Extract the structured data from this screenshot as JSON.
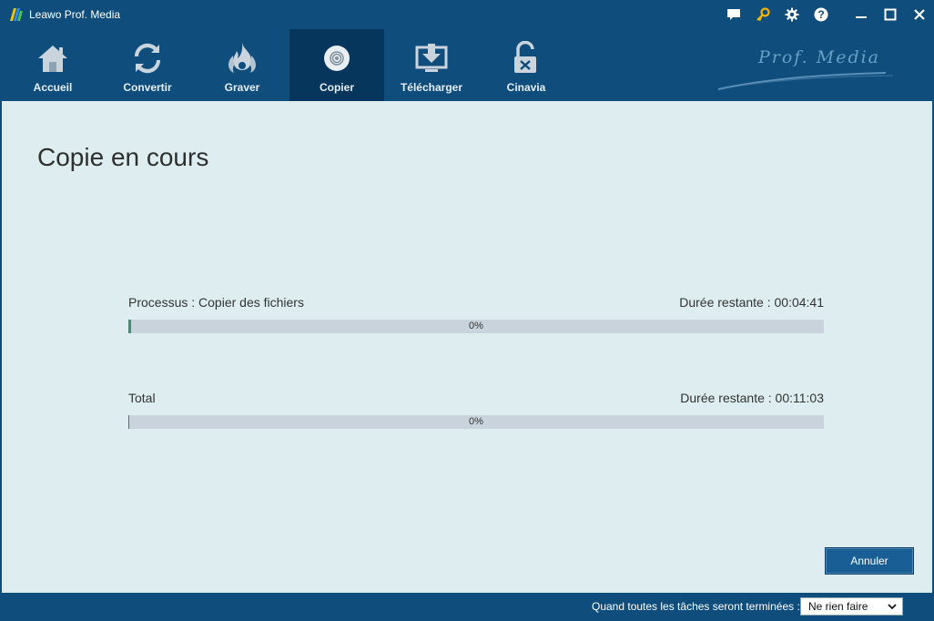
{
  "window": {
    "title": "Leawo Prof. Media"
  },
  "titlebar": {
    "icons": [
      "chat-icon",
      "key-icon",
      "gear-icon",
      "help-icon",
      "minimize-icon",
      "maximize-icon",
      "close-icon"
    ]
  },
  "nav": {
    "items": [
      {
        "label": "Accueil",
        "icon": "home-icon"
      },
      {
        "label": "Convertir",
        "icon": "convert-icon"
      },
      {
        "label": "Graver",
        "icon": "burn-icon"
      },
      {
        "label": "Copier",
        "icon": "disc-icon",
        "active": true
      },
      {
        "label": "Télécharger",
        "icon": "download-icon"
      },
      {
        "label": "Cinavia",
        "icon": "unlock-icon"
      }
    ],
    "brand": "Prof. Media"
  },
  "main": {
    "title": "Copie en cours",
    "process": {
      "label": "Processus :  Copier des fichiers",
      "remaining": "Durée restante :  00:04:41",
      "percent_text": "0%",
      "progress": 0.0,
      "fill_color": "#3f8f6e"
    },
    "total": {
      "label": "Total",
      "remaining": "Durée restante :  00:11:03",
      "percent_text": "0%",
      "progress": 0.0,
      "fill_color": "#3e6fa3"
    },
    "cancel_label": "Annuler"
  },
  "footer": {
    "label": "Quand toutes les tâches seront terminées :",
    "select_value": "Ne rien faire"
  },
  "colors": {
    "chrome": "#0e4d7c",
    "active_tab": "#07365c",
    "content_bg": "#ddedf0",
    "accent_key": "#f2b705"
  }
}
